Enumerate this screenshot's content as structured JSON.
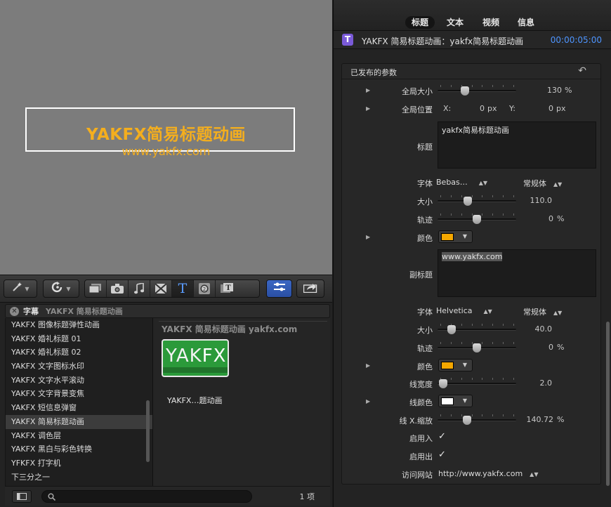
{
  "viewer": {
    "title": "YAKFX简易标题动画",
    "subtitle": "www.yakfx.com"
  },
  "toolbar": {
    "buttons": [
      {
        "name": "magic-wand-icon"
      },
      {
        "name": "rotate-icon"
      },
      {
        "name": "clips-icon"
      },
      {
        "name": "camera-icon"
      },
      {
        "name": "music-icon"
      },
      {
        "name": "transitions-icon"
      },
      {
        "name": "titles-icon",
        "glyph": "T"
      },
      {
        "name": "generators-icon"
      },
      {
        "name": "themes-icon"
      },
      {
        "name": "inspector-icon"
      },
      {
        "name": "share-icon"
      }
    ]
  },
  "browser": {
    "category": "字幕",
    "selected_title": "YAKFX 简易标题动画",
    "list": [
      "YAKFX 图像标题弹性动画",
      "YAKFX 婚礼标题 01",
      "YAKFX 婚礼标题 02",
      "YAKFX 文字图标水印",
      "YAKFX 文字水平滚动",
      "YAKFX 文字背景变焦",
      "YAKFX 短信息弹窗",
      "YAKFX 简易标题动画",
      "YAKFX 调色层",
      "YAKFX 黑白与彩色转换",
      "YFKFX 打字机",
      "下三分之一"
    ],
    "selected_index": 7,
    "grid_title": "YAKFX 简易标题动画 yakfx.com",
    "thumb_text_a": "YAK",
    "thumb_text_b": "FX",
    "thumb_label": "YAKFX…题动画",
    "count": "1 项"
  },
  "inspector": {
    "tabs": [
      "标题",
      "文本",
      "视频",
      "信息"
    ],
    "selected_tab": 0,
    "badge": "T",
    "name": "YAKFX 简易标题动画：yakfx简易标题动画",
    "timecode": "00:00:05:00",
    "section": "已发布的参数",
    "params": {
      "global_scale": {
        "label": "全局大小",
        "value": "130",
        "unit": "%",
        "level": 0.33
      },
      "global_pos": {
        "label": "全局位置",
        "x_label": "X:",
        "x_value": "0",
        "x_unit": "px",
        "y_label": "Y:",
        "y_value": "0",
        "y_unit": "px"
      },
      "title": {
        "label": "标题",
        "value": "yakfx简易标题动画"
      },
      "title_font": {
        "label": "字体",
        "family": "Bebas…",
        "style": "常规体"
      },
      "title_size": {
        "label": "大小",
        "value": "110.0",
        "level": 0.37
      },
      "title_tracking": {
        "label": "轨迹",
        "value": "0",
        "unit": "%",
        "level": 0.5
      },
      "title_color": {
        "label": "颜色",
        "color": "#f5a800"
      },
      "subtitle": {
        "label": "副标题",
        "value": "www.yakfx.com"
      },
      "sub_font": {
        "label": "字体",
        "family": "Helvetica",
        "style": "常规体"
      },
      "sub_size": {
        "label": "大小",
        "value": "40.0",
        "level": 0.14
      },
      "sub_tracking": {
        "label": "轨迹",
        "value": "0",
        "unit": "%",
        "level": 0.5
      },
      "sub_color": {
        "label": "颜色",
        "color": "#f5a800"
      },
      "line_width": {
        "label": "线宽度",
        "value": "2.0",
        "level": 0.02
      },
      "line_color": {
        "label": "线颜色",
        "color": "#ffffff"
      },
      "line_x_scale": {
        "label": "线 X.缩放",
        "value": "140.72",
        "unit": "%",
        "level": 0.36
      },
      "enable_in": {
        "label": "启用入",
        "check": "✓"
      },
      "enable_out": {
        "label": "启用出",
        "check": "✓"
      },
      "website": {
        "label": "访问网站",
        "value": "http://www.yakfx.com"
      }
    }
  }
}
